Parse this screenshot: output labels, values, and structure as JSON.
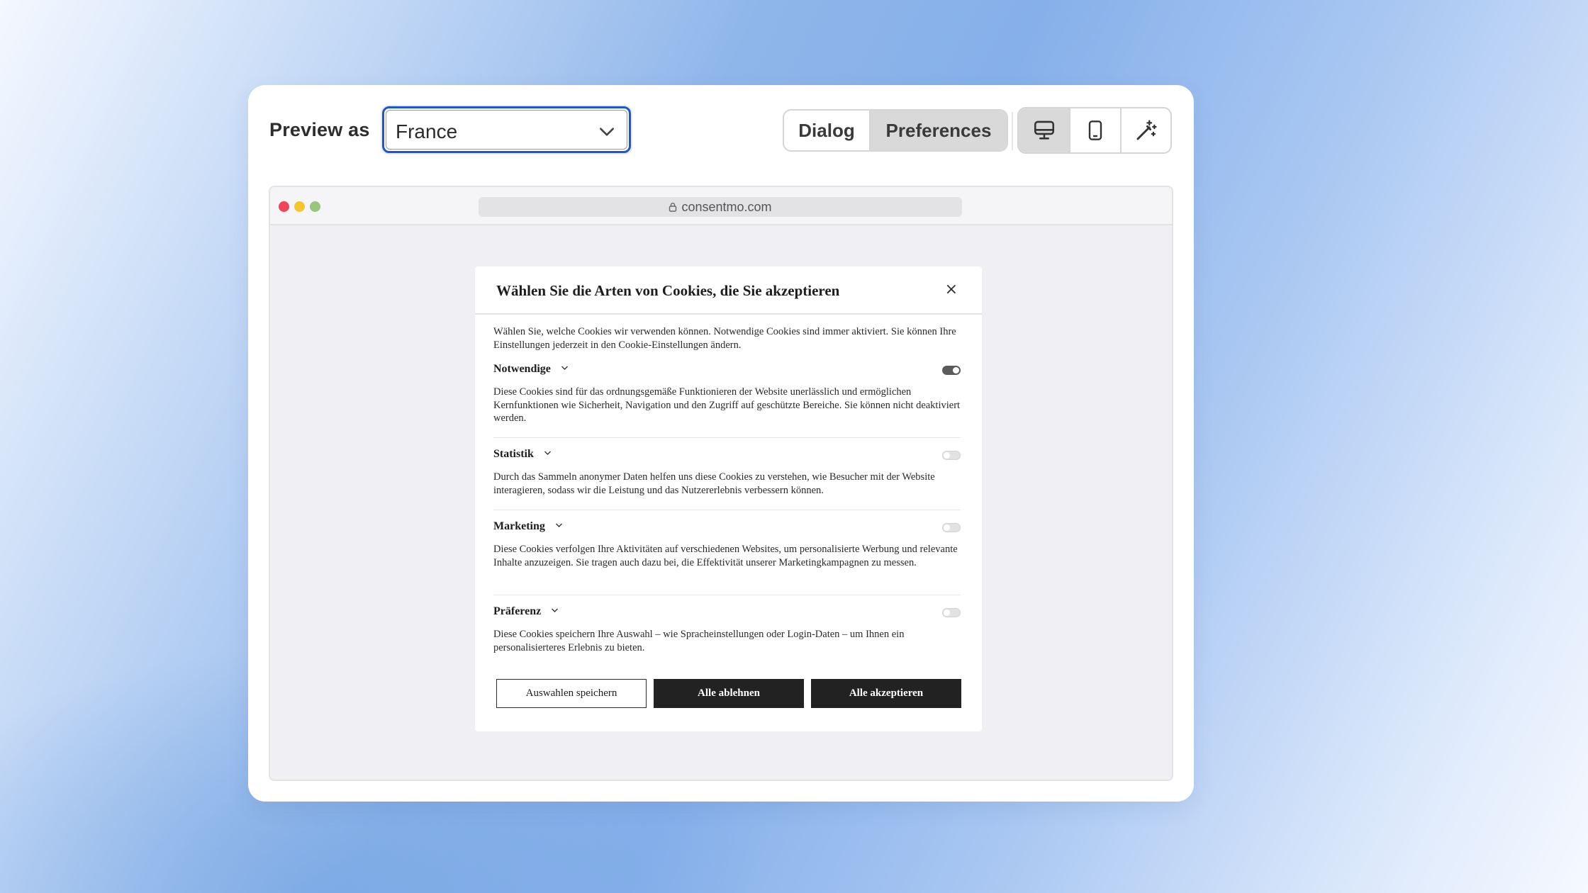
{
  "toolbar": {
    "preview_label": "Preview as",
    "country_select": {
      "value": "France"
    },
    "view_modes": {
      "dialog": "Dialog",
      "preferences": "Preferences",
      "selected": "Preferences"
    },
    "devices": {
      "selected": "desktop",
      "items": [
        "desktop-icon",
        "mobile-icon",
        "magic-wand-icon"
      ]
    }
  },
  "browser": {
    "url": "consentmo.com"
  },
  "modal": {
    "title": "Wählen Sie die Arten von Cookies, die Sie akzeptieren",
    "close": "×",
    "intro": "Wählen Sie, welche Cookies wir verwenden können. Notwendige Cookies sind immer aktiviert. Sie können Ihre Einstellungen jederzeit in den Cookie-Einstellungen ändern.",
    "categories": [
      {
        "name": "Notwendige",
        "enabled": true,
        "description": "Diese Cookies sind für das ordnungsgemäße Funktionieren der Website unerlässlich und ermöglichen Kernfunktionen wie Sicherheit, Navigation und den Zugriff auf geschützte Bereiche. Sie können nicht deaktiviert werden."
      },
      {
        "name": "Statistik",
        "enabled": false,
        "description": "Durch das Sammeln anonymer Daten helfen uns diese Cookies zu verstehen, wie Besucher mit der Website interagieren, sodass wir die Leistung und das Nutzererlebnis verbessern können."
      },
      {
        "name": "Marketing",
        "enabled": false,
        "description": "Diese Cookies verfolgen Ihre Aktivitäten auf verschiedenen Websites, um personalisierte Werbung und relevante Inhalte anzuzeigen. Sie tragen auch dazu bei, die Effektivität unserer Marketingkampagnen zu messen."
      },
      {
        "name": "Präferenz",
        "enabled": false,
        "description": "Diese Cookies speichern Ihre Auswahl – wie Spracheinstellungen oder Login-Daten – um Ihnen ein personalisierteres Erlebnis zu bieten."
      }
    ],
    "buttons": {
      "save": "Auswahlen speichern",
      "reject": "Alle ablehnen",
      "accept": "Alle akzeptieren"
    }
  },
  "colors": {
    "focus_ring": "#1f56c9",
    "button_dark": "#222222",
    "toggle_on": "#5b5b5b"
  }
}
